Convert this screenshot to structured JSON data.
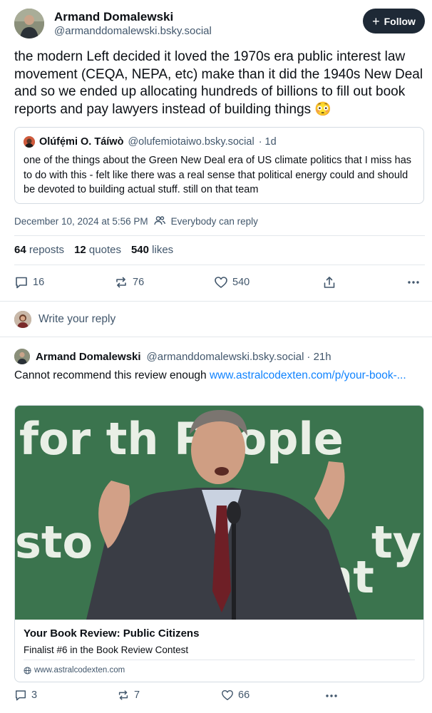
{
  "post": {
    "author_name": "Armand Domalewski",
    "author_handle": "@armanddomalewski.bsky.social",
    "follow_label": "Follow",
    "text": "the modern Left decided it loved the 1970s era public interest law movement (CEQA, NEPA, etc) make than it did the 1940s New Deal and so we ended up allocating hundreds of billions to fill out book reports and pay lawyers instead of building things 😳",
    "quote": {
      "author_name": "Olúfẹ́mi O. Táíwò",
      "author_handle": "@olufemiotaiwo.bsky.social",
      "age": "· 1d",
      "text": "one of the things about the Green New Deal era of US climate politics that I miss has to do with this - felt like there was a real sense that political energy could and should be devoted to building actual stuff. still on that team"
    },
    "timestamp": "December 10, 2024 at 5:56 PM",
    "reply_setting": "Everybody can reply",
    "stats": {
      "reposts_count": "64",
      "reposts_label": "reposts",
      "quotes_count": "12",
      "quotes_label": "quotes",
      "likes_count": "540",
      "likes_label": "likes"
    },
    "actions": {
      "replies": "16",
      "reposts": "76",
      "likes": "540"
    }
  },
  "reply_composer": {
    "placeholder": "Write your reply"
  },
  "reply_post": {
    "author_name": "Armand Domalewski",
    "author_handle": "@armanddomalewski.bsky.social",
    "age": "· 21h",
    "text": "Cannot recommend this review enough ",
    "link_text": "www.astralcodexten.com/p/your-book-...",
    "card": {
      "image_text_line1": "for th People",
      "image_text_line2": "sto",
      "image_text_line2b": "ty",
      "image_text_line3": "ent",
      "title": "Your Book Review: Public Citizens",
      "description": "Finalist #6 in the Book Review Contest",
      "domain": "www.astralcodexten.com"
    },
    "actions": {
      "replies": "3",
      "reposts": "7",
      "likes": "66"
    }
  },
  "colors": {
    "accent_link": "#1083fe",
    "follow_bg": "#1e2936",
    "muted_text": "#42576c",
    "banner_green": "#3f7a52"
  }
}
